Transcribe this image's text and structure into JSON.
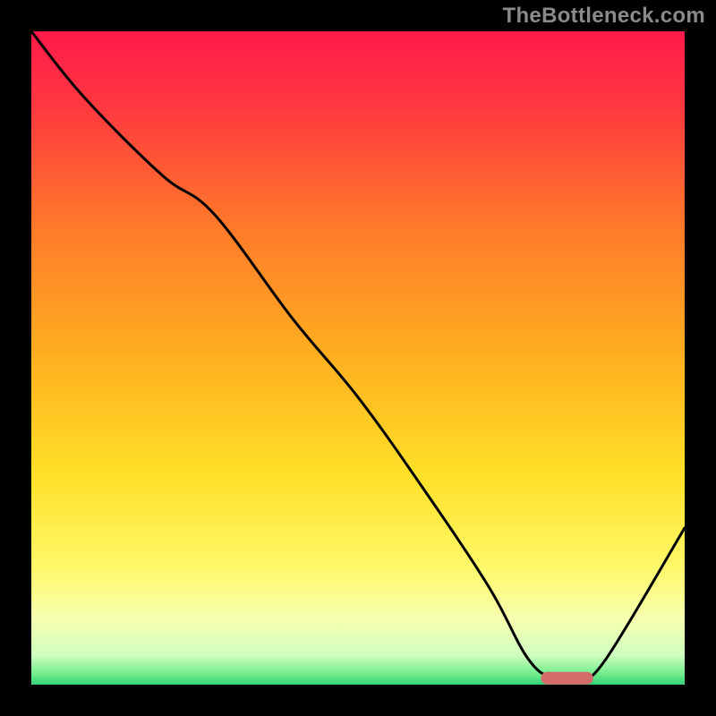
{
  "watermark": "TheBottleneck.com",
  "chart_data": {
    "type": "line",
    "title": "",
    "xlabel": "",
    "ylabel": "",
    "xlim": [
      0,
      100
    ],
    "ylim": [
      0,
      100
    ],
    "x": [
      0,
      8,
      20,
      28,
      40,
      50,
      60,
      70,
      76,
      80,
      84,
      88,
      100
    ],
    "values": [
      100,
      90,
      78,
      72,
      56,
      44,
      30,
      15,
      4,
      1,
      1,
      4,
      24
    ],
    "optimum_marker": {
      "x_start": 78,
      "x_end": 86,
      "y": 1
    },
    "background_gradient": {
      "type": "vertical",
      "stops": [
        {
          "offset": 0.0,
          "color": "#ff1a4b"
        },
        {
          "offset": 0.12,
          "color": "#ff3a3f"
        },
        {
          "offset": 0.3,
          "color": "#ff7a2a"
        },
        {
          "offset": 0.5,
          "color": "#ffb020"
        },
        {
          "offset": 0.68,
          "color": "#ffe028"
        },
        {
          "offset": 0.82,
          "color": "#fff86a"
        },
        {
          "offset": 0.9,
          "color": "#f6ffb0"
        },
        {
          "offset": 0.955,
          "color": "#cfffc0"
        },
        {
          "offset": 0.985,
          "color": "#6eeb8a"
        },
        {
          "offset": 1.0,
          "color": "#2fd278"
        }
      ]
    },
    "curve_color": "#000000",
    "marker_color": "#d66b6b"
  }
}
